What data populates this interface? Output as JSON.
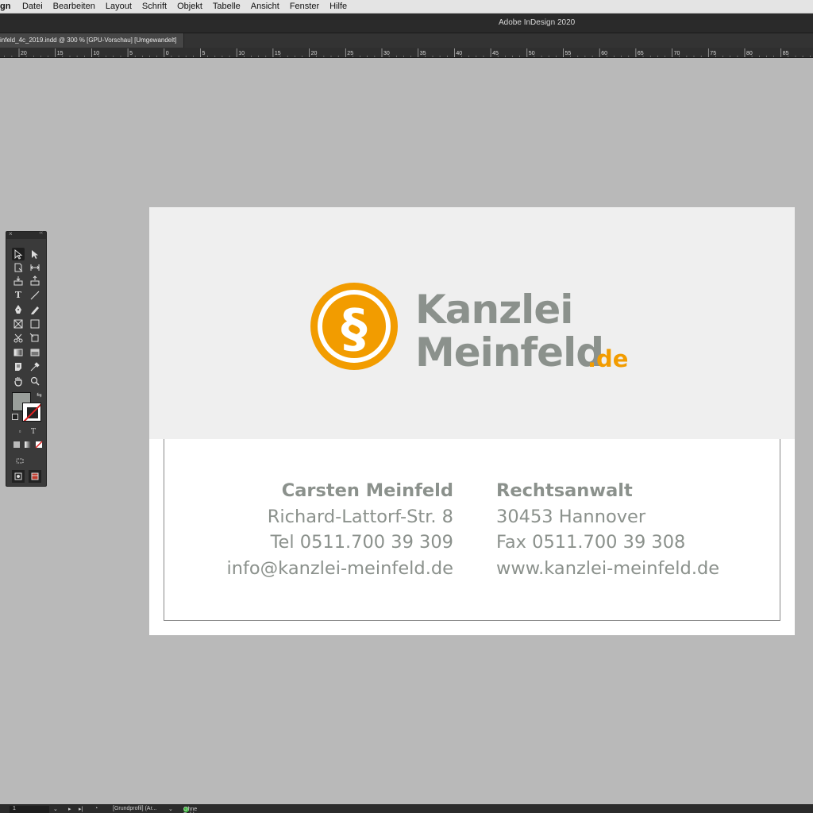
{
  "menubar": {
    "app_name": "gn",
    "items": [
      "Datei",
      "Bearbeiten",
      "Layout",
      "Schrift",
      "Objekt",
      "Tabelle",
      "Ansicht",
      "Fenster",
      "Hilfe"
    ]
  },
  "app": {
    "title": "Adobe InDesign 2020"
  },
  "document_tab": {
    "label": "infeld_4c_2019.indd @ 300 % [GPU-Vorschau] [Umgewandelt]"
  },
  "ruler": {
    "labels": [
      "20",
      "15",
      "10",
      "5",
      "0",
      "5",
      "10",
      "15",
      "20",
      "25",
      "30",
      "35",
      "40",
      "45",
      "50",
      "55",
      "60",
      "65",
      "70",
      "75",
      "80",
      "85"
    ]
  },
  "tools": {
    "icons": [
      "selection-tool-icon",
      "direct-selection-tool-icon",
      "page-tool-icon",
      "gap-tool-icon",
      "content-collector-icon",
      "content-placer-icon",
      "type-tool-icon",
      "line-tool-icon",
      "pen-tool-icon",
      "pencil-tool-icon",
      "rectangle-frame-tool-icon",
      "rectangle-tool-icon",
      "scissors-tool-icon",
      "free-transform-tool-icon",
      "gradient-swatch-tool-icon",
      "gradient-feather-tool-icon",
      "note-tool-icon",
      "eyedropper-tool-icon",
      "hand-tool-icon",
      "zoom-tool-icon"
    ],
    "type_glyph": "T",
    "fill_color": "#9a9f9b"
  },
  "card": {
    "brand_line1": "Kanzlei",
    "brand_line2": "Meinfeld",
    "brand_tld": ".de",
    "logo_symbol": "§",
    "colors": {
      "accent": "#f29c00",
      "gray": "#8b918c",
      "band": "#efefef"
    },
    "left_column": [
      "Carsten Meinfeld",
      "Richard-Lattorf-Str. 8",
      "Tel 0511.700 39 309",
      "info@kanzlei-meinfeld.de"
    ],
    "right_column": [
      "Rechtsanwalt",
      "30453 Hannover",
      "Fax 0511.700 39 308",
      "www.kanzlei-meinfeld.de"
    ]
  },
  "statusbar": {
    "page_number": "1",
    "profile": "[Grundprofil] (Ar...",
    "preflight": "Ohne Fehler"
  }
}
